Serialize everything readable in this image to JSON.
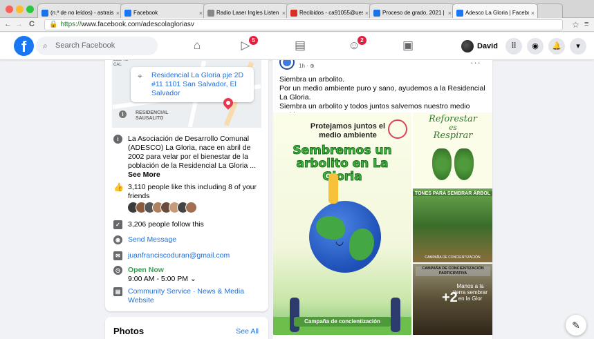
{
  "browser": {
    "tabs": [
      {
        "label": "(n.º de no leídos) - astrais",
        "favicon_color": "#1a73e8",
        "active": false
      },
      {
        "label": "Facebook",
        "favicon_color": "#1877f2",
        "active": false
      },
      {
        "label": "Radio Laser Ingles Listen Li",
        "favicon_color": "#888888",
        "active": false
      },
      {
        "label": "Recibidos - ca91055@ues",
        "favicon_color": "#d93025",
        "active": false
      },
      {
        "label": "Proceso de grado, 2021 | E",
        "favicon_color": "#1a73e8",
        "active": false
      },
      {
        "label": "Adesco La Gloria | Facebo",
        "favicon_color": "#1877f2",
        "active": true
      }
    ],
    "close_glyph": "×",
    "url_scheme": "https://",
    "url": "www.facebook.com/adescolagloriasv"
  },
  "fb_header": {
    "logo_letter": "f",
    "search_placeholder": "Search Facebook",
    "watch_badge": "5",
    "groups_badge": "2",
    "profile_name": "David"
  },
  "about": {
    "map": {
      "top_label": "BEE TE\nCAL",
      "address": "Residencial La Gloria pje 2D #11 1101 San Salvador, El Salvador",
      "place_label": "RESIDENCIAL SAUSALITO"
    },
    "description": "La Asociación de Desarrollo Comunal (ADESCO) La Gloria, nace en abril de 2002 para velar por el bienestar de la población de la Residencial La Gloria ...",
    "see_more": "See More",
    "likes": "3,110 people like this including 8 of your friends",
    "follows": "3,206 people follow this",
    "send_message": "Send Message",
    "email": "juanfranciscoduran@gmail.com",
    "open_now": "Open Now",
    "hours": "9:00 AM - 5:00 PM",
    "category": "Community Service · News & Media Website"
  },
  "photos": {
    "title": "Photos",
    "see_all": "See All"
  },
  "post": {
    "time": "1h · ",
    "more": "···",
    "lines": [
      "Siembra un arbolito.",
      "Por un medio ambiente puro y sano, ayudemos a la Residencial La Gloria.",
      "Siembra un arbolito y todos juntos salvemos nuestro medio ambiente."
    ],
    "image_main": {
      "heading": "Protejamos juntos el medio ambiente",
      "title": "Sembremos un arbolito en La Gloria",
      "banner": "Campaña de concientización"
    },
    "image_side1": {
      "line1": "Reforestar",
      "line2": "es",
      "line3": "Respirar"
    },
    "image_side2": {
      "caption": "TONES PARA SEMBRAR ÁRBOL",
      "footer": "CAMPAÑA DE CONCIENTIZACIÓN"
    },
    "image_side3": {
      "caption": "CAMPAÑA DE CONCIENTIZACIÓN PARTICIPATIVA",
      "text": "Manos a la tierra sembrar en la Glor",
      "more_count": "+2"
    }
  }
}
